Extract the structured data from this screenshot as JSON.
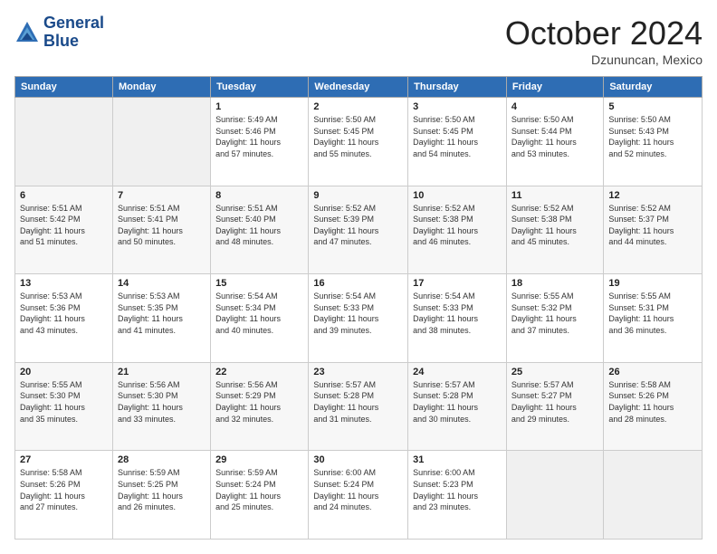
{
  "header": {
    "logo_line1": "General",
    "logo_line2": "Blue",
    "month": "October 2024",
    "location": "Dzununcan, Mexico"
  },
  "weekdays": [
    "Sunday",
    "Monday",
    "Tuesday",
    "Wednesday",
    "Thursday",
    "Friday",
    "Saturday"
  ],
  "weeks": [
    [
      {
        "day": "",
        "info": ""
      },
      {
        "day": "",
        "info": ""
      },
      {
        "day": "1",
        "info": "Sunrise: 5:49 AM\nSunset: 5:46 PM\nDaylight: 11 hours\nand 57 minutes."
      },
      {
        "day": "2",
        "info": "Sunrise: 5:50 AM\nSunset: 5:45 PM\nDaylight: 11 hours\nand 55 minutes."
      },
      {
        "day": "3",
        "info": "Sunrise: 5:50 AM\nSunset: 5:45 PM\nDaylight: 11 hours\nand 54 minutes."
      },
      {
        "day": "4",
        "info": "Sunrise: 5:50 AM\nSunset: 5:44 PM\nDaylight: 11 hours\nand 53 minutes."
      },
      {
        "day": "5",
        "info": "Sunrise: 5:50 AM\nSunset: 5:43 PM\nDaylight: 11 hours\nand 52 minutes."
      }
    ],
    [
      {
        "day": "6",
        "info": "Sunrise: 5:51 AM\nSunset: 5:42 PM\nDaylight: 11 hours\nand 51 minutes."
      },
      {
        "day": "7",
        "info": "Sunrise: 5:51 AM\nSunset: 5:41 PM\nDaylight: 11 hours\nand 50 minutes."
      },
      {
        "day": "8",
        "info": "Sunrise: 5:51 AM\nSunset: 5:40 PM\nDaylight: 11 hours\nand 48 minutes."
      },
      {
        "day": "9",
        "info": "Sunrise: 5:52 AM\nSunset: 5:39 PM\nDaylight: 11 hours\nand 47 minutes."
      },
      {
        "day": "10",
        "info": "Sunrise: 5:52 AM\nSunset: 5:38 PM\nDaylight: 11 hours\nand 46 minutes."
      },
      {
        "day": "11",
        "info": "Sunrise: 5:52 AM\nSunset: 5:38 PM\nDaylight: 11 hours\nand 45 minutes."
      },
      {
        "day": "12",
        "info": "Sunrise: 5:52 AM\nSunset: 5:37 PM\nDaylight: 11 hours\nand 44 minutes."
      }
    ],
    [
      {
        "day": "13",
        "info": "Sunrise: 5:53 AM\nSunset: 5:36 PM\nDaylight: 11 hours\nand 43 minutes."
      },
      {
        "day": "14",
        "info": "Sunrise: 5:53 AM\nSunset: 5:35 PM\nDaylight: 11 hours\nand 41 minutes."
      },
      {
        "day": "15",
        "info": "Sunrise: 5:54 AM\nSunset: 5:34 PM\nDaylight: 11 hours\nand 40 minutes."
      },
      {
        "day": "16",
        "info": "Sunrise: 5:54 AM\nSunset: 5:33 PM\nDaylight: 11 hours\nand 39 minutes."
      },
      {
        "day": "17",
        "info": "Sunrise: 5:54 AM\nSunset: 5:33 PM\nDaylight: 11 hours\nand 38 minutes."
      },
      {
        "day": "18",
        "info": "Sunrise: 5:55 AM\nSunset: 5:32 PM\nDaylight: 11 hours\nand 37 minutes."
      },
      {
        "day": "19",
        "info": "Sunrise: 5:55 AM\nSunset: 5:31 PM\nDaylight: 11 hours\nand 36 minutes."
      }
    ],
    [
      {
        "day": "20",
        "info": "Sunrise: 5:55 AM\nSunset: 5:30 PM\nDaylight: 11 hours\nand 35 minutes."
      },
      {
        "day": "21",
        "info": "Sunrise: 5:56 AM\nSunset: 5:30 PM\nDaylight: 11 hours\nand 33 minutes."
      },
      {
        "day": "22",
        "info": "Sunrise: 5:56 AM\nSunset: 5:29 PM\nDaylight: 11 hours\nand 32 minutes."
      },
      {
        "day": "23",
        "info": "Sunrise: 5:57 AM\nSunset: 5:28 PM\nDaylight: 11 hours\nand 31 minutes."
      },
      {
        "day": "24",
        "info": "Sunrise: 5:57 AM\nSunset: 5:28 PM\nDaylight: 11 hours\nand 30 minutes."
      },
      {
        "day": "25",
        "info": "Sunrise: 5:57 AM\nSunset: 5:27 PM\nDaylight: 11 hours\nand 29 minutes."
      },
      {
        "day": "26",
        "info": "Sunrise: 5:58 AM\nSunset: 5:26 PM\nDaylight: 11 hours\nand 28 minutes."
      }
    ],
    [
      {
        "day": "27",
        "info": "Sunrise: 5:58 AM\nSunset: 5:26 PM\nDaylight: 11 hours\nand 27 minutes."
      },
      {
        "day": "28",
        "info": "Sunrise: 5:59 AM\nSunset: 5:25 PM\nDaylight: 11 hours\nand 26 minutes."
      },
      {
        "day": "29",
        "info": "Sunrise: 5:59 AM\nSunset: 5:24 PM\nDaylight: 11 hours\nand 25 minutes."
      },
      {
        "day": "30",
        "info": "Sunrise: 6:00 AM\nSunset: 5:24 PM\nDaylight: 11 hours\nand 24 minutes."
      },
      {
        "day": "31",
        "info": "Sunrise: 6:00 AM\nSunset: 5:23 PM\nDaylight: 11 hours\nand 23 minutes."
      },
      {
        "day": "",
        "info": ""
      },
      {
        "day": "",
        "info": ""
      }
    ]
  ]
}
